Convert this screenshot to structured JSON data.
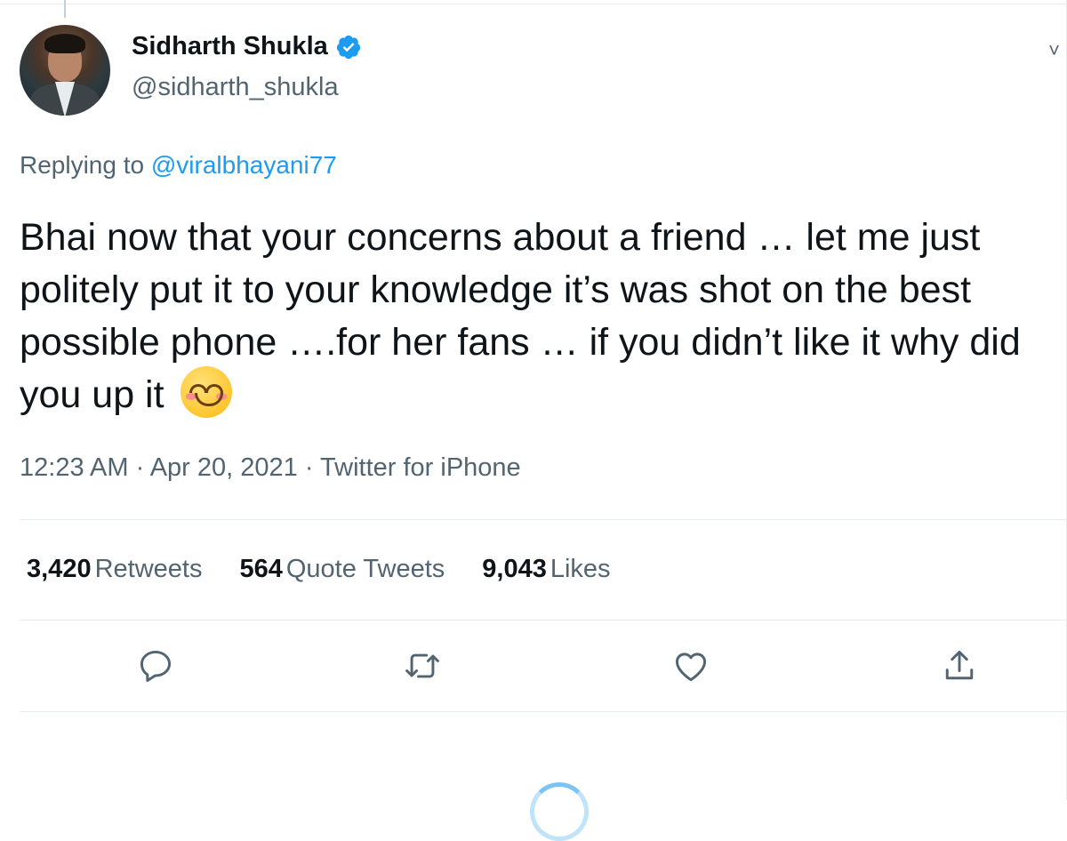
{
  "tweet": {
    "author": {
      "display_name": "Sidharth Shukla",
      "handle": "@sidharth_shukla",
      "verified": true
    },
    "reply": {
      "prefix": "Replying to ",
      "mention": "@viralbhayani77"
    },
    "text": "Bhai now that your concerns about a friend … let me just politely put it to your knowledge it’s was shot on the best possible phone ….for her fans … if you didn’t like it why did you up it",
    "emoji": "smiling-face-with-smiling-eyes",
    "meta": "12:23 AM · Apr 20, 2021 · Twitter for iPhone",
    "stats": [
      {
        "count": "3,420",
        "label": "Retweets"
      },
      {
        "count": "564",
        "label": "Quote Tweets"
      },
      {
        "count": "9,043",
        "label": "Likes"
      }
    ],
    "actions": [
      "reply-icon",
      "retweet-icon",
      "like-icon",
      "share-icon"
    ]
  },
  "colors": {
    "accent": "#1d9bf0",
    "secondary_text": "#536471",
    "primary_text": "#0f1419",
    "divider": "#e6ecf0"
  }
}
